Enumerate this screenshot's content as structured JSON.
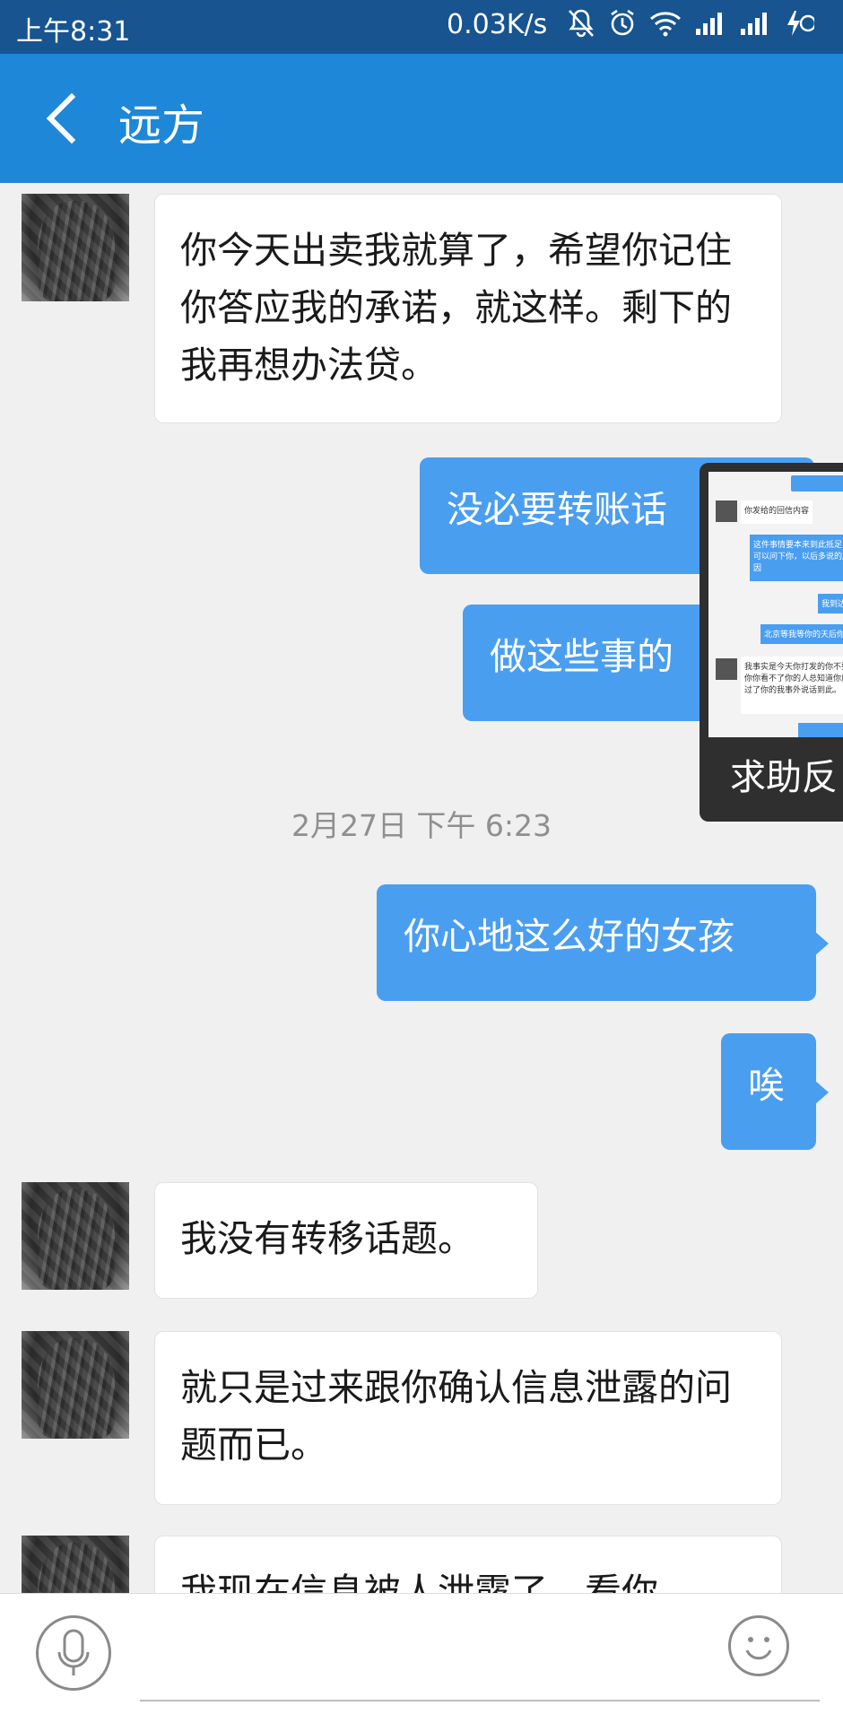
{
  "status_bar": {
    "time": "上午8:31",
    "speed": "0.03K/s",
    "icons": [
      "mute-bell-icon",
      "alarm-icon",
      "wifi-icon",
      "signal-icon",
      "signal-icon",
      "charging-icon"
    ]
  },
  "header": {
    "title": "远方",
    "back_icon": "chevron-left-icon",
    "background": "#1e87d8"
  },
  "messages": [
    {
      "direction": "in",
      "text": "你今天出卖我就算了，希望你记住你答应我的承诺，就这样。剩下的我再想办法贷。"
    },
    {
      "direction": "out",
      "text": "没必要转账话"
    },
    {
      "direction": "out",
      "text": "做这些事的"
    },
    {
      "direction": "out",
      "text": "你心地这么好的女孩"
    },
    {
      "direction": "out",
      "text": "唉"
    },
    {
      "direction": "in",
      "text": "我没有转移话题。"
    },
    {
      "direction": "in",
      "text": "就只是过来跟你确认信息泄露的问题而已。"
    },
    {
      "direction": "in",
      "text": "我现在信息被人泄露了，看你"
    }
  ],
  "timestamp": "2月27日 下午 6:23",
  "floating_panel": {
    "label": "求助反",
    "snippets": [
      "你发给的回信内容",
      "这件事情要本来到此抵足，可以问下你，以后多说的原因",
      "我到达",
      "北京等我等你的天后你说",
      "我事实是今天你打发的你不要到你你看不了你的人总知道你后，过了你的我事外说话到此。"
    ]
  },
  "input_bar": {
    "mic_icon": "microphone-icon",
    "emoji_icon": "smiley-icon",
    "placeholder": ""
  },
  "colors": {
    "status_bar": "#175490",
    "outgoing_bubble": "#4a9ef0",
    "incoming_bubble": "#ffffff",
    "chat_background": "#f0f0f0"
  }
}
